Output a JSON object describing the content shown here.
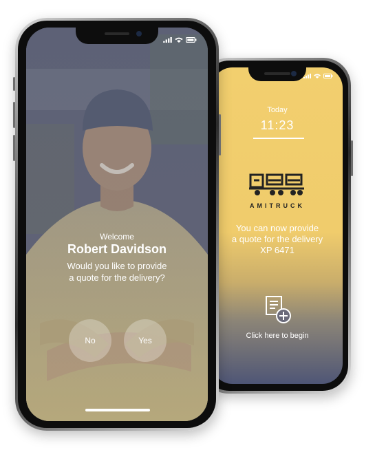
{
  "back_screen": {
    "date_label": "Today",
    "time": "11:23",
    "brand": "AMITRUCK",
    "message_line1": "You can now provide",
    "message_line2": "a quote for the delivery",
    "message_line3": "XP 6471",
    "begin_label": "Click here to begin",
    "icons": [
      "truck-logo-icon",
      "document-add-icon",
      "signal-icon",
      "wifi-icon",
      "battery-icon"
    ]
  },
  "front_screen": {
    "overline": "Welcome",
    "name": "Robert Davidson",
    "question_line1": "Would you like to provide",
    "question_line2": "a quote for the delivery?",
    "no_label": "No",
    "yes_label": "Yes",
    "icons": [
      "signal-icon",
      "wifi-icon",
      "battery-icon"
    ]
  },
  "colors": {
    "accent_yellow": "#f0cc6c",
    "dusk_blue": "#4f5676",
    "text_light": "#ffffff",
    "brand_dark": "#222222"
  }
}
